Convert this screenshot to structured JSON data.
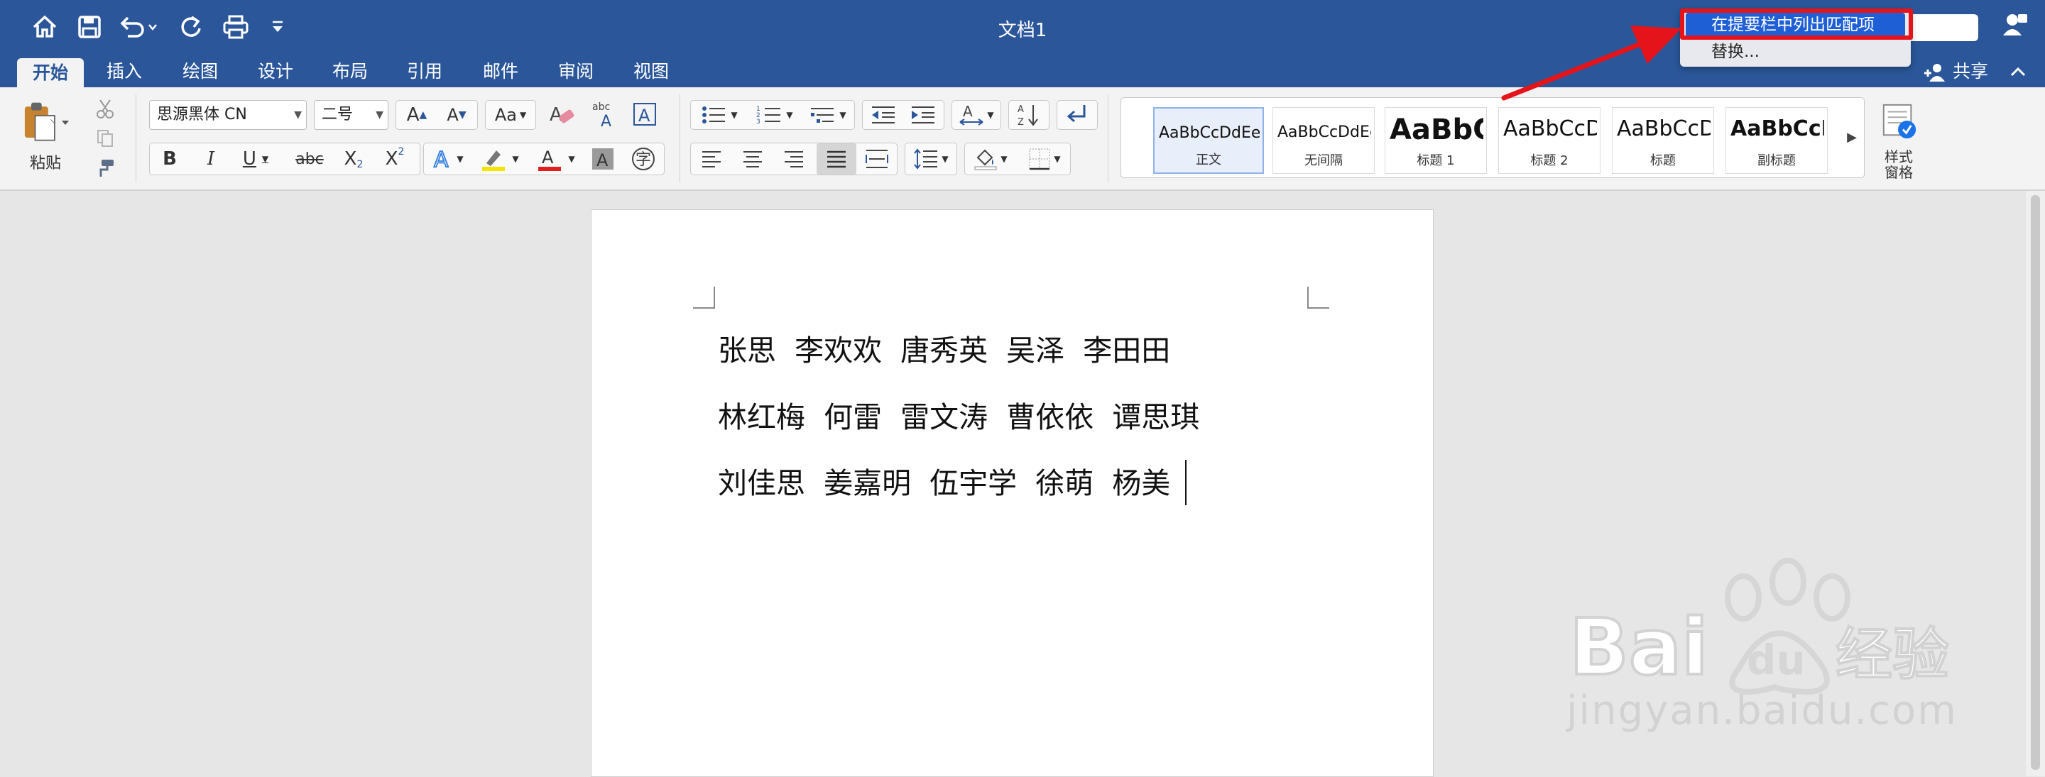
{
  "window": {
    "title": "文档1"
  },
  "tabs": [
    {
      "label": "开始",
      "active": true
    },
    {
      "label": "插入"
    },
    {
      "label": "绘图"
    },
    {
      "label": "设计"
    },
    {
      "label": "布局"
    },
    {
      "label": "引用"
    },
    {
      "label": "邮件"
    },
    {
      "label": "审阅"
    },
    {
      "label": "视图"
    }
  ],
  "share": {
    "label": "共享"
  },
  "search": {
    "options": [
      "在提要栏中列出匹配项",
      "替换..."
    ]
  },
  "ribbon": {
    "paste_label": "粘贴",
    "font_name": "思源黑体 CN",
    "font_size": "二号",
    "style_pane_label": "样式\n窗格",
    "styles": [
      {
        "sample": "AaBbCcDdEe",
        "name": "正文"
      },
      {
        "sample": "AaBbCcDdEe",
        "name": "无间隔"
      },
      {
        "sample": "AaBbC",
        "name": "标题 1"
      },
      {
        "sample": "AaBbCcD",
        "name": "标题 2"
      },
      {
        "sample": "AaBbCcD",
        "name": "标题"
      },
      {
        "sample": "AaBbCcD",
        "name": "副标题"
      }
    ],
    "text_color": "#e02020",
    "highlight_color": "#f5e400"
  },
  "document": {
    "lines": [
      "张思  李欢欢  唐秀英  吴泽  李田田",
      "林红梅  何雷  雷文涛  曹依依  谭思琪",
      "刘佳思  姜嘉明  伍宇学  徐萌  杨美"
    ]
  },
  "watermark": {
    "brand": "Baidu",
    "product": "经验",
    "url": "jingyan.baidu.com"
  },
  "colors": {
    "titlebar": "#2b579a",
    "accent_red": "#e5141a"
  }
}
